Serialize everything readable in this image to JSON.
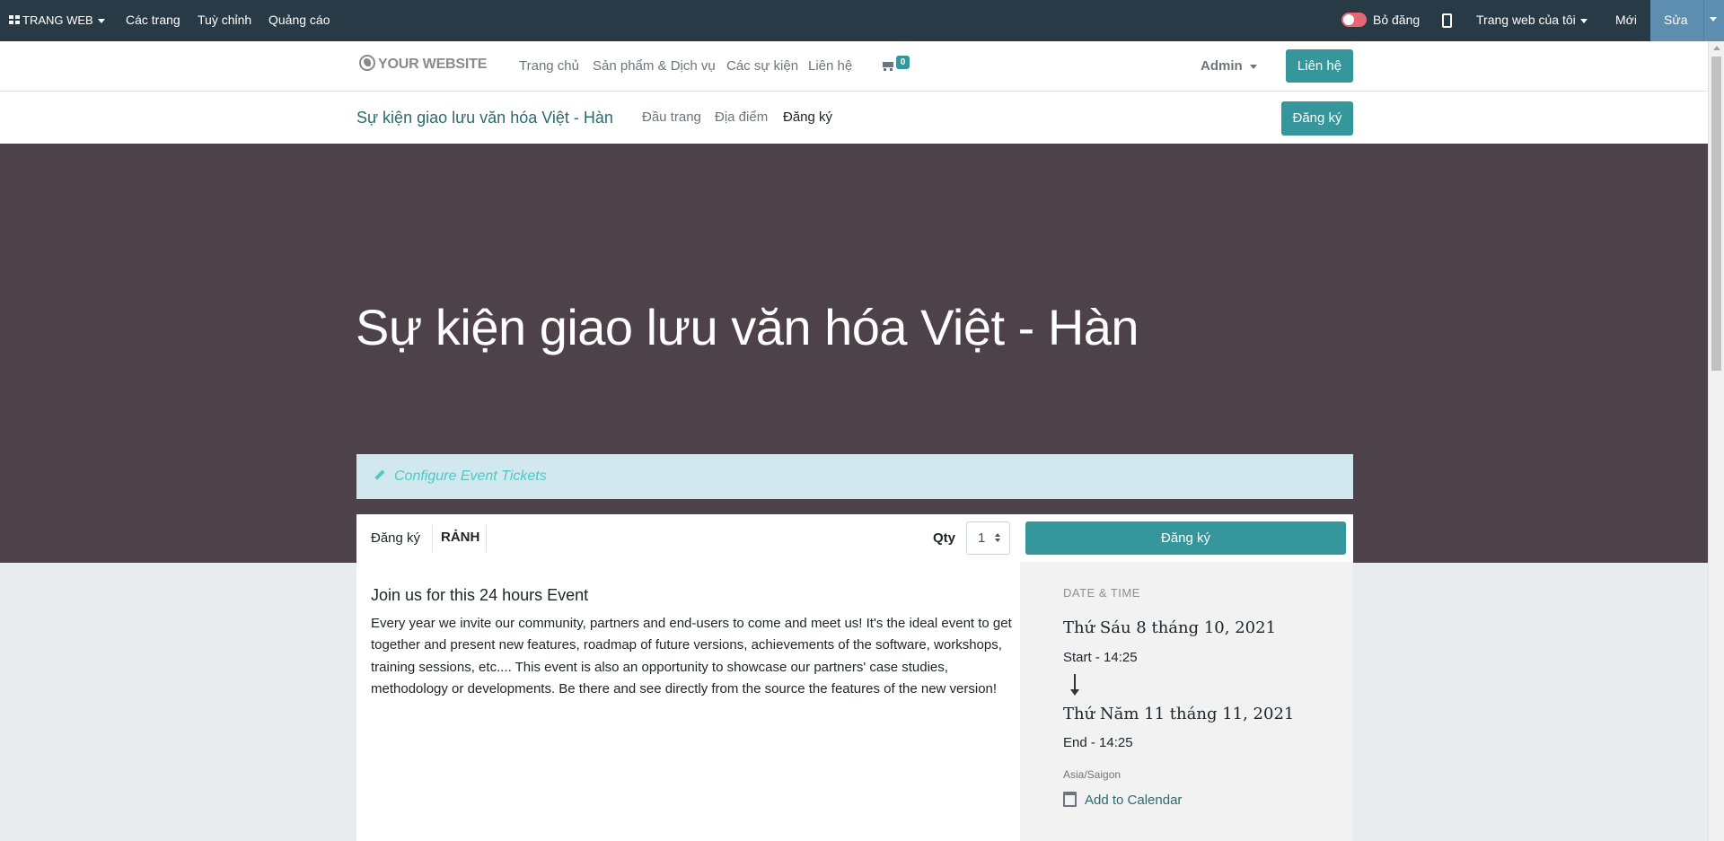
{
  "editor_bar": {
    "apps_label": "TRANG WEB",
    "menu": [
      "Các trang",
      "Tuỳ chỉnh",
      "Quảng cáo"
    ],
    "publish_label": "Bỏ đăng",
    "published": true,
    "my_website_label": "Trang web của tôi",
    "new_label": "Mới",
    "edit_label": "Sửa"
  },
  "site_header": {
    "logo_text": "YOUR WEBSITE",
    "nav": [
      "Trang chủ",
      "Sản phẩm & Dịch vụ",
      "Các sự kiện",
      "Liên hệ"
    ],
    "cart_count": "0",
    "user": "Admin",
    "contact_button": "Liên hệ"
  },
  "event_nav": {
    "title": "Sự kiện giao lưu văn hóa Việt - Hàn",
    "tabs": [
      "Đầu trang",
      "Địa điểm",
      "Đăng ký"
    ],
    "active_tab": "Đăng ký",
    "register_button": "Đăng ký"
  },
  "hero": {
    "title": "Sự kiện giao lưu văn hóa Việt - Hàn",
    "background": "#4d414a"
  },
  "notice": {
    "label": "Configure Event Tickets"
  },
  "registration": {
    "ticket_name": "Đăng ký",
    "ticket_status": "RẢNH",
    "qty_label": "Qty",
    "qty_value": "1",
    "register_button": "Đăng ký"
  },
  "description": {
    "title": "Join us for this 24 hours Event",
    "body": "Every year we invite our community, partners and end-users to come and meet us! It's the ideal event to get together and present new features, roadmap of future versions, achievements of the software, workshops, training sessions, etc.... This event is also an opportunity to showcase our partners' case studies, methodology or developments. Be there and see directly from the source the features of the new version!"
  },
  "date_time": {
    "heading": "DATE & TIME",
    "start_date": "Thứ Sáu 8 tháng 10, 2021",
    "start_time": "Start - 14:25",
    "end_date": "Thứ Năm 11 tháng 11, 2021",
    "end_time": "End - 14:25",
    "timezone": "Asia/Saigon",
    "add_to_calendar": "Add to Calendar"
  },
  "colors": {
    "editor_bar": "#283a46",
    "accent": "#35979c",
    "edit_button": "#5d8eb0",
    "notice_bg": "#d1e8ee"
  },
  "icons": [
    "apps-icon",
    "caret-down-icon",
    "toggle-switch",
    "mobile-icon",
    "globe-icon",
    "cart-icon",
    "pencil-icon",
    "arrow-down-icon",
    "calendar-icon"
  ]
}
